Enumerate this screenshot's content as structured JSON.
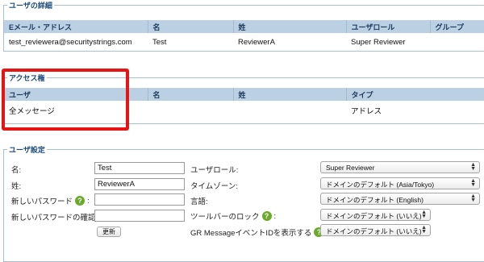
{
  "user_details": {
    "legend": "ユーザの詳細",
    "headers": [
      "Eメール・アドレス",
      "名",
      "姓",
      "ユーザロール",
      "グループ"
    ],
    "row": {
      "email": "test_reviewera@securitystrings.com",
      "first": "Test",
      "last": "ReviewerA",
      "role": "Super Reviewer",
      "group": ""
    },
    "role_color": "#e0201c"
  },
  "access": {
    "legend": "アクセス権",
    "headers": [
      "ユーザ",
      "名",
      "姓",
      "タイプ"
    ],
    "row": {
      "user": "全メッセージ",
      "first": "",
      "last": "",
      "type": "アドレス"
    }
  },
  "settings": {
    "legend": "ユーザ設定",
    "first_label": "名:",
    "first_value": "Test",
    "last_label": "姓:",
    "last_value": "ReviewerA",
    "new_password_label": "新しいパスワード",
    "confirm_password_label": "新しいパスワードの確認:",
    "update_button": "更新",
    "role_label": "ユーザロール:",
    "role_value": "Super Reviewer",
    "timezone_label": "タイムゾーン:",
    "timezone_value": "ドメインのデフォルト (Asia/Tokyo)",
    "language_label": "言語:",
    "language_value": "ドメインのデフォルト (English)",
    "toolbar_lock_label": "ツールバーのロック",
    "toolbar_lock_value": "ドメインのデフォルト (いいえ)",
    "gr_event_label": "GR MessageイベントIDを表示する",
    "gr_event_value": "ドメインのデフォルト (いいえ)",
    "help_glyph": "?",
    "colon": ":"
  },
  "colors": {
    "header_bg": "#bcd0e4",
    "highlight": "#e51515",
    "help_icon": "#6aaa2a"
  }
}
